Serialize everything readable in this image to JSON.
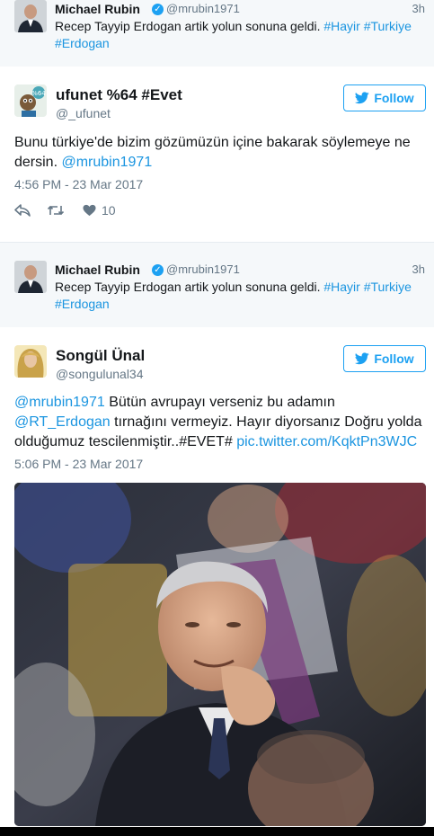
{
  "quoted_top": {
    "name": "Michael Rubin",
    "handle": "@mrubin1971",
    "time": "3h",
    "text_plain": "Recep Tayyip Erdogan artik yolun sonuna geldi. ",
    "hashtag_1": "#Hayir",
    "hashtag_2": "#Turkiye",
    "hashtag_3": "#Erdogan"
  },
  "tweet1": {
    "name": "ufunet %64 #Evet",
    "handle": "@_ufunet",
    "follow_label": "Follow",
    "text_plain": "Bunu türkiye'de bizim gözümüzün içine bakarak söylemeye ne dersin. ",
    "mention": "@mrubin1971",
    "date": "4:56 PM - 23 Mar 2017",
    "like_count": "10"
  },
  "quoted_mid": {
    "name": "Michael Rubin",
    "handle": "@mrubin1971",
    "time": "3h",
    "text_plain": "Recep Tayyip Erdogan artik yolun sonuna geldi. ",
    "hashtag_1": "#Hayir",
    "hashtag_2": "#Turkiye",
    "hashtag_3": "#Erdogan"
  },
  "tweet2": {
    "name": "Songül Ünal",
    "handle": "@songulunal34",
    "follow_label": "Follow",
    "mention_1": "@mrubin1971",
    "text_1": " Bütün avrupayı verseniz bu adamın ",
    "mention_2": "@RT_Erdogan",
    "text_2": " tırnağını vermeyiz. Hayır diyorsanız Doğru yolda olduğumuz tescilenmiştir..#EVET# ",
    "pic_link": "pic.twitter.com/KqktPn3WJC",
    "date": "5:06 PM - 23 Mar 2017"
  },
  "icons": {
    "reply": "reply-icon",
    "retweet": "retweet-icon",
    "like": "heart-icon",
    "twitter": "twitter-bird-icon",
    "verified": "verified-badge-icon"
  },
  "colors": {
    "link": "#1b95e0",
    "follow": "#1da1f2",
    "muted": "#657786",
    "quoted_bg": "#f5f8fa"
  }
}
